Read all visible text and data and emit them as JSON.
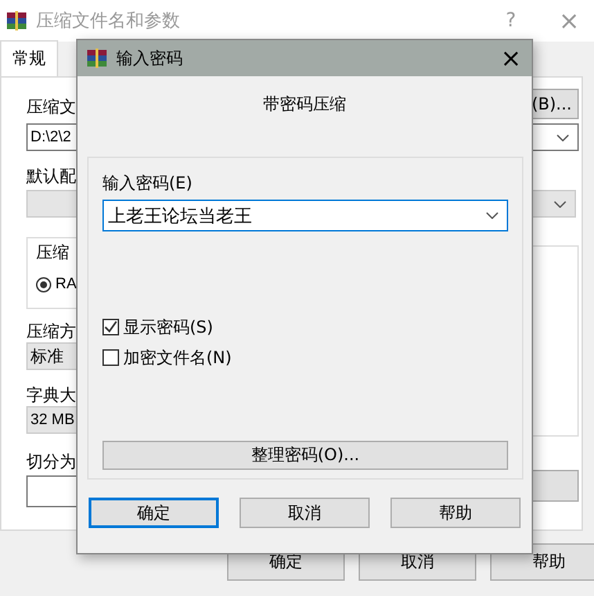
{
  "window": {
    "title": "压缩文件名和参数",
    "help": "?",
    "close": "×"
  },
  "tabs": [
    {
      "label": "常规",
      "selected": true
    }
  ],
  "general": {
    "archive_label": "压缩文",
    "browse_button": "(B)...",
    "archive_path": "D:\\2\\2",
    "profile_label": "默认配",
    "format_group": "压缩",
    "format_option": {
      "label": "RA",
      "selected": true
    },
    "method_label": "压缩方",
    "method_value": "标准",
    "dictionary_label": "字典大",
    "dictionary_value": "32 MB",
    "split_label": "切分为"
  },
  "buttons": [
    "确定",
    "取消",
    "帮助"
  ],
  "dialog": {
    "title": "输入密码",
    "close": "×",
    "heading": "带密码压缩",
    "password_label": "输入密码(E)",
    "password_value": "上老王论坛当老王",
    "options": [
      {
        "label": "显示密码(S)",
        "checked": true
      },
      {
        "label": "加密文件名(N)",
        "checked": false
      }
    ],
    "organize_button": "整理密码(O)...",
    "buttons": [
      {
        "label": "确定",
        "default": true
      },
      {
        "label": "取消",
        "default": false
      },
      {
        "label": "帮助",
        "default": false
      }
    ]
  }
}
